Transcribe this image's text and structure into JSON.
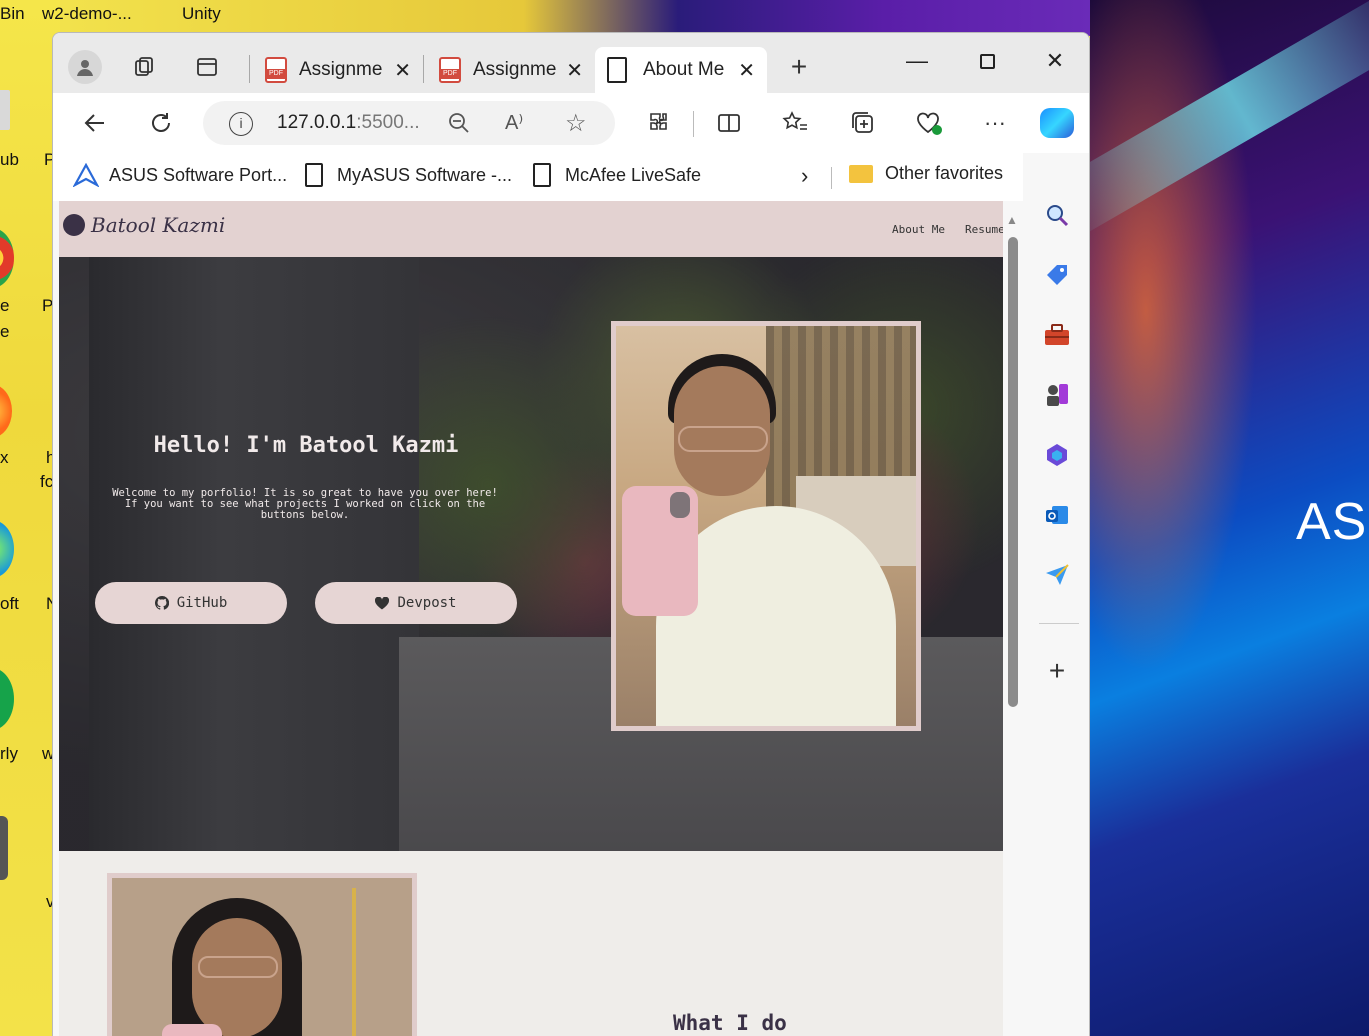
{
  "desktop": {
    "labels": [
      "Bin",
      "w2-demo-...",
      "Unity",
      "ub",
      "P",
      "e",
      "e",
      "P",
      "x",
      "h",
      "fc",
      "oft",
      "N",
      "rly",
      "w",
      "v"
    ],
    "brand_text": "ASU"
  },
  "browser": {
    "tabs": [
      {
        "title": "Assignme",
        "icon": "pdf-icon"
      },
      {
        "title": "Assignme",
        "icon": "pdf-icon"
      },
      {
        "title": "About Me",
        "icon": "page-icon",
        "active": true
      }
    ],
    "address": {
      "url_main": "127.0.0.1",
      "url_rest": ":5500..."
    },
    "favorites": [
      {
        "label": "ASUS Software Port...",
        "icon": "asus-icon"
      },
      {
        "label": "MyASUS Software -...",
        "icon": "page-icon"
      },
      {
        "label": "McAfee LiveSafe",
        "icon": "page-icon"
      }
    ],
    "other_favorites": "Other favorites"
  },
  "site": {
    "brand": "Batool Kazmi",
    "nav": [
      "About Me",
      "Resume"
    ],
    "hero": {
      "title": "Hello! I'm Batool Kazmi",
      "text": "Welcome to my porfolio! It is so great to have you over here! If you want to see what projects I worked on click on the buttons below.",
      "buttons": [
        {
          "label": "GitHub",
          "icon": "github-icon"
        },
        {
          "label": "Devpost",
          "icon": "heart-icon"
        }
      ]
    },
    "about": {
      "heading": "What I do"
    }
  },
  "colors": {
    "nav_bg": "#e3d2d1",
    "button_bg": "#e6d5d4",
    "page_bg": "#efedea",
    "accent_text": "#3a3146"
  }
}
